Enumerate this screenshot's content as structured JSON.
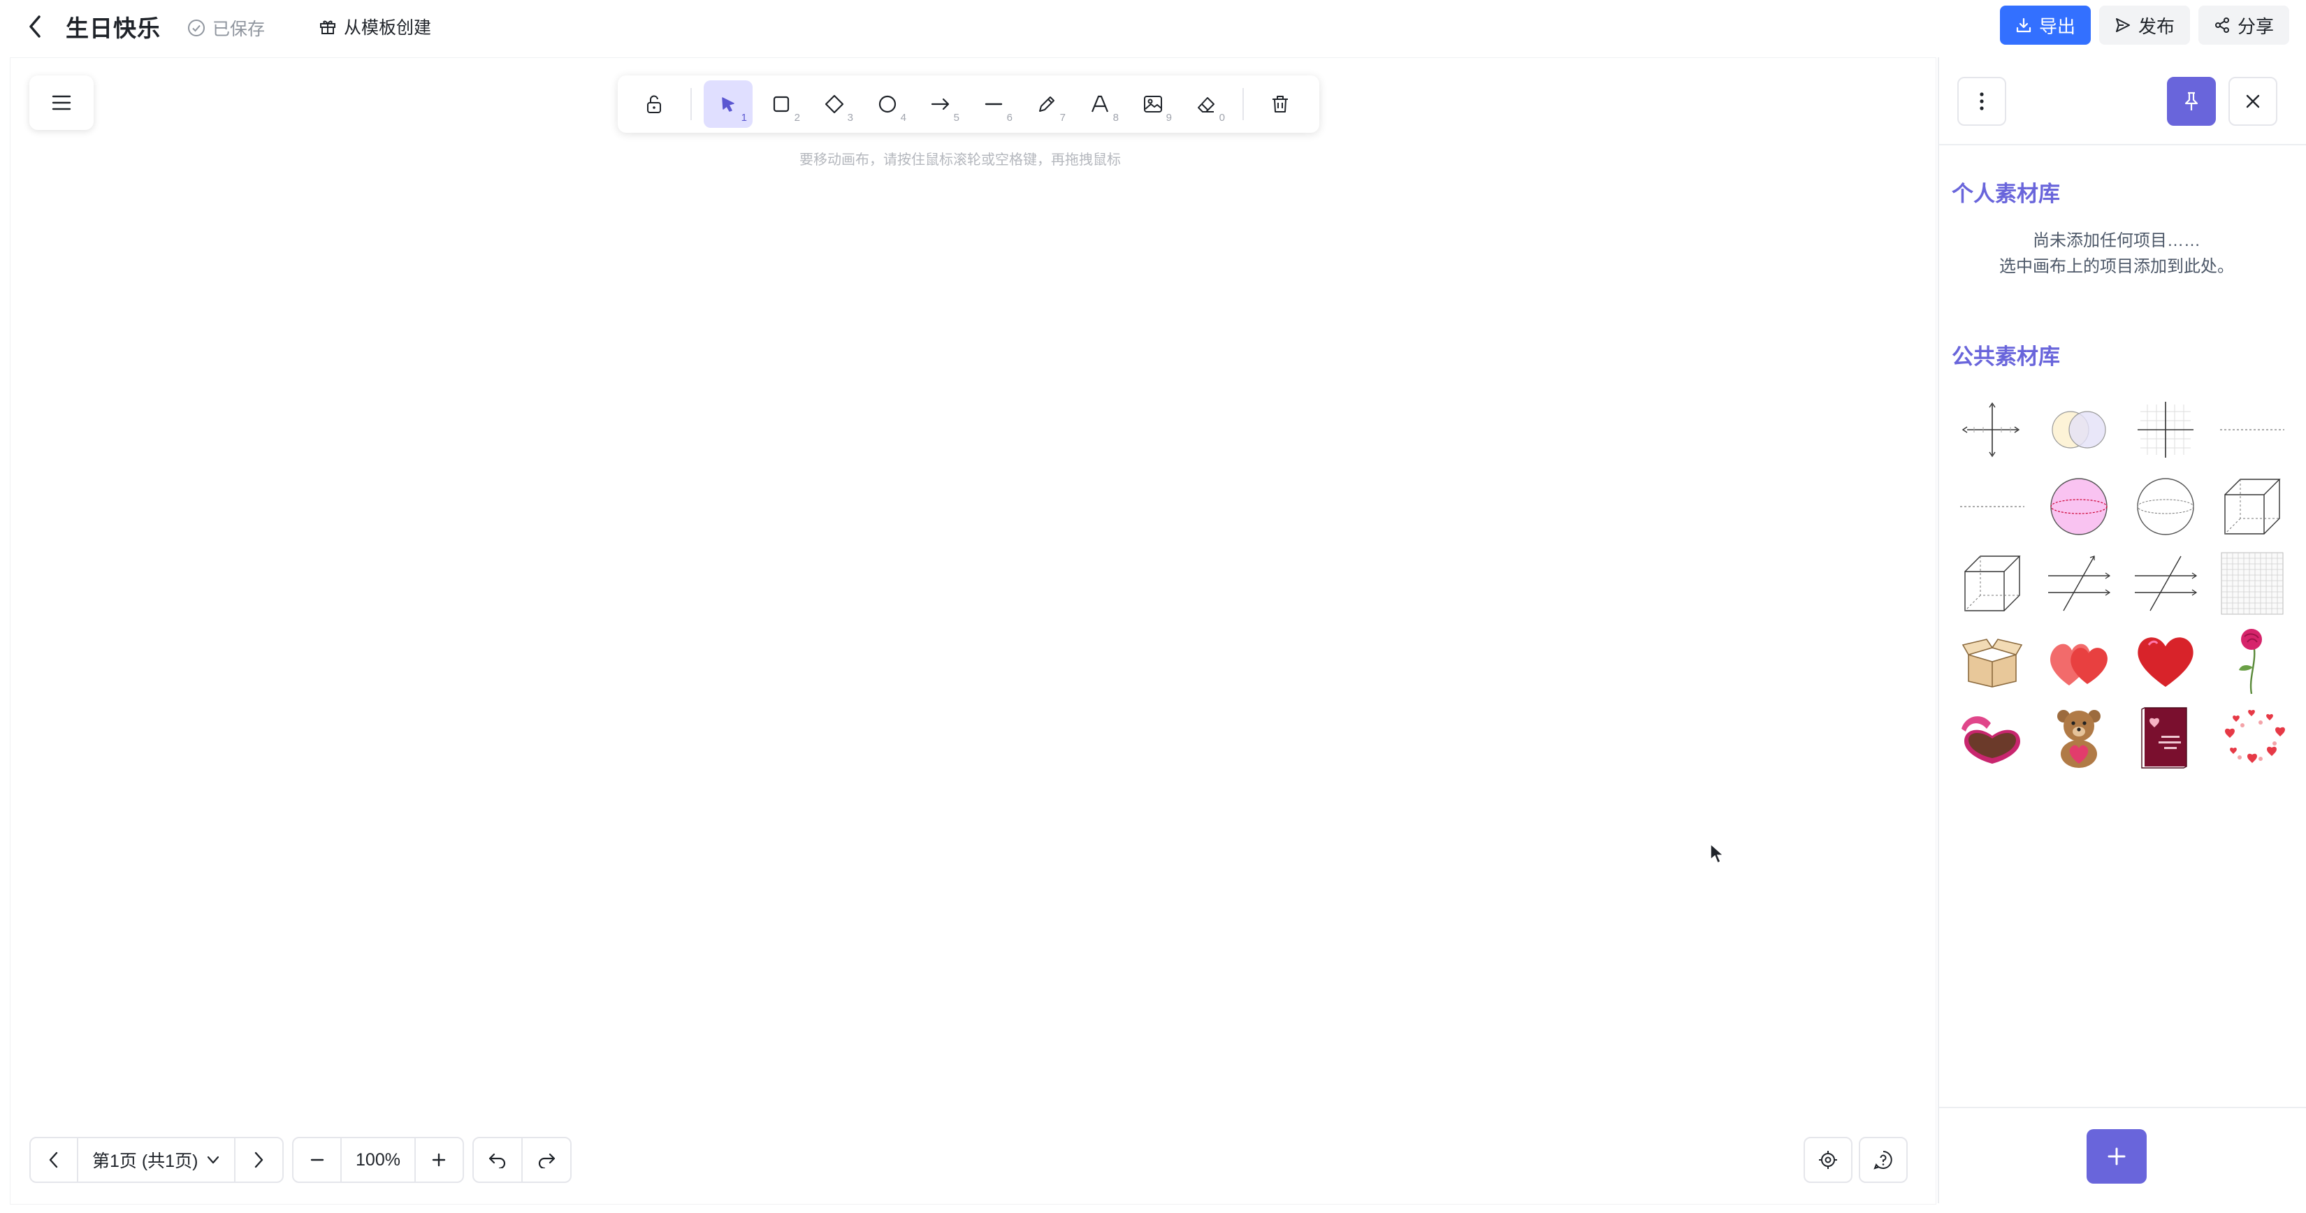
{
  "header": {
    "title": "生日快乐",
    "saved_status": "已保存",
    "template_label": "从模板创建",
    "export_label": "导出",
    "publish_label": "发布",
    "share_label": "分享",
    "accent_color": "#3370ff"
  },
  "toolbar": {
    "tools": [
      {
        "name": "select",
        "icon": "pointer-icon",
        "key": "1",
        "active": true
      },
      {
        "name": "rectangle",
        "icon": "square-icon",
        "key": "2"
      },
      {
        "name": "diamond",
        "icon": "diamond-icon",
        "key": "3"
      },
      {
        "name": "ellipse",
        "icon": "circle-icon",
        "key": "4"
      },
      {
        "name": "arrow",
        "icon": "arrow-icon",
        "key": "5"
      },
      {
        "name": "line",
        "icon": "line-icon",
        "key": "6"
      },
      {
        "name": "draw",
        "icon": "pencil-icon",
        "key": "7"
      },
      {
        "name": "text",
        "icon": "text-icon",
        "key": "8"
      },
      {
        "name": "image",
        "icon": "image-icon",
        "key": "9"
      },
      {
        "name": "eraser",
        "icon": "eraser-icon",
        "key": "0"
      }
    ],
    "hint": "要移动画布，请按住鼠标滚轮或空格键，再拖拽鼠标"
  },
  "footer": {
    "page_label": "第1页 (共1页)",
    "zoom": "100%"
  },
  "library": {
    "personal_title": "个人素材库",
    "empty_line1": "尚未添加任何项目……",
    "empty_line2": "选中画布上的项目添加到此处。",
    "public_title": "公共素材库",
    "accent_color": "#6965db",
    "items": [
      "axes-icon",
      "venn-diagram-icon",
      "grid-axes-icon",
      "dotted-line-icon",
      "dotted-line-icon",
      "pink-sphere-icon",
      "sphere-icon",
      "cube-icon",
      "cube-icon",
      "parallel-lines-icon",
      "parallel-lines-icon",
      "grid-icon",
      "gift-box-icon",
      "double-heart-icon",
      "heart-icon",
      "rose-icon",
      "chocolate-box-icon",
      "teddy-bear-icon",
      "valentine-card-icon",
      "hearts-wreath-icon"
    ]
  }
}
